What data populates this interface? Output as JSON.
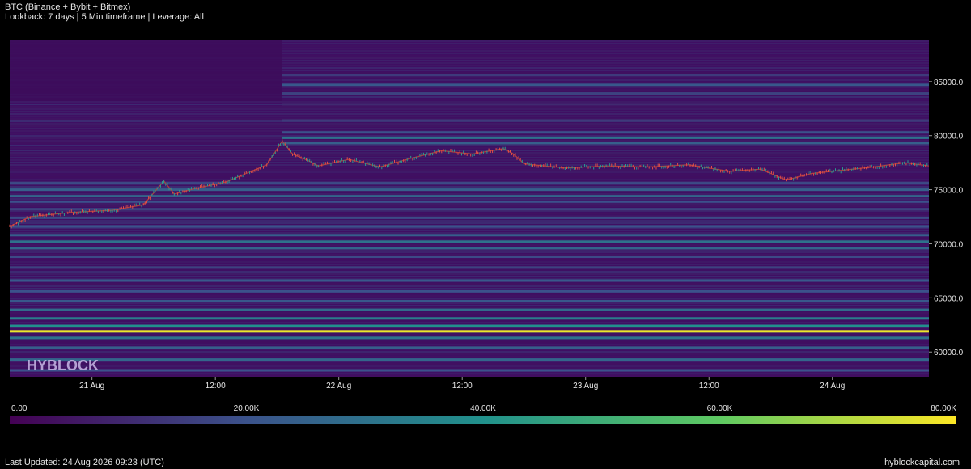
{
  "header": {
    "title": "BTC (Binance + Bybit + Bitmex)",
    "subtitle": "Lookback: 7 days | 5 Min timeframe | Leverage: All"
  },
  "watermark": "HYBLOCK",
  "footer": {
    "last_updated": "Last Updated: 24 Aug 2026 09:23 (UTC)",
    "site": "hyblockcapital.com"
  },
  "colors": {
    "background": "#000000",
    "heatmap_low": "#440154",
    "heatmap_mid1": "#3b528b",
    "heatmap_mid2": "#21918c",
    "heatmap_mid3": "#5ec962",
    "heatmap_high": "#fde725",
    "candle_up": "#26a69a",
    "candle_down": "#ef5350"
  },
  "chart_data": {
    "type": "heatmap",
    "description_of_overlay": "candlestick",
    "x_tick_labels": [
      "21 Aug",
      "12:00",
      "22 Aug",
      "12:00",
      "23 Aug",
      "12:00",
      "24 Aug"
    ],
    "x_range": [
      "2026-08-20T16:00",
      "2026-08-24T09:23"
    ],
    "x_ticks": [
      "2026-08-21T00:00",
      "2026-08-21T12:00",
      "2026-08-22T00:00",
      "2026-08-22T12:00",
      "2026-08-23T00:00",
      "2026-08-23T12:00",
      "2026-08-24T00:00"
    ],
    "y_tick_labels": [
      "85000.0",
      "80000.0",
      "75000.0",
      "70000.0",
      "65000.0",
      "60000.0"
    ],
    "y_ticks": [
      85000,
      80000,
      75000,
      70000,
      65000,
      60000
    ],
    "ylim": [
      57700,
      88800
    ],
    "colorbar": {
      "range": [
        0,
        80000
      ],
      "tick_labels": [
        "0.00",
        "20.00K",
        "40.00K",
        "60.00K",
        "80.00K"
      ],
      "tick_values": [
        0,
        20000,
        40000,
        60000,
        80000
      ]
    },
    "price_path": [
      [
        "2026-08-20T16:00",
        71600
      ],
      [
        "2026-08-20T18:00",
        72500
      ],
      [
        "2026-08-20T22:00",
        72900
      ],
      [
        "2026-08-21T02:00",
        73100
      ],
      [
        "2026-08-21T05:00",
        73600
      ],
      [
        "2026-08-21T07:00",
        75800
      ],
      [
        "2026-08-21T08:00",
        74600
      ],
      [
        "2026-08-21T10:00",
        75100
      ],
      [
        "2026-08-21T13:00",
        75700
      ],
      [
        "2026-08-21T15:00",
        76500
      ],
      [
        "2026-08-21T17:00",
        77300
      ],
      [
        "2026-08-21T18:30",
        79500
      ],
      [
        "2026-08-21T19:30",
        78300
      ],
      [
        "2026-08-21T21:00",
        77700
      ],
      [
        "2026-08-21T22:00",
        77200
      ],
      [
        "2026-08-22T01:00",
        77800
      ],
      [
        "2026-08-22T04:00",
        77100
      ],
      [
        "2026-08-22T07:00",
        77900
      ],
      [
        "2026-08-22T10:00",
        78600
      ],
      [
        "2026-08-22T13:00",
        78300
      ],
      [
        "2026-08-22T16:00",
        78800
      ],
      [
        "2026-08-22T17:00",
        78300
      ],
      [
        "2026-08-22T18:00",
        77400
      ],
      [
        "2026-08-22T22:00",
        77000
      ],
      [
        "2026-08-23T02:00",
        77200
      ],
      [
        "2026-08-23T06:00",
        77100
      ],
      [
        "2026-08-23T10:00",
        77300
      ],
      [
        "2026-08-23T14:00",
        76700
      ],
      [
        "2026-08-23T17:00",
        76900
      ],
      [
        "2026-08-23T19:30",
        75900
      ],
      [
        "2026-08-23T22:00",
        76500
      ],
      [
        "2026-08-24T01:00",
        76800
      ],
      [
        "2026-08-24T04:00",
        77100
      ],
      [
        "2026-08-24T07:00",
        77500
      ],
      [
        "2026-08-24T09:23",
        77200
      ]
    ],
    "liquidation_bands": [
      {
        "price": 87200,
        "value": 6000
      },
      {
        "price": 85600,
        "value": 14000
      },
      {
        "price": 84700,
        "value": 22000
      },
      {
        "price": 83900,
        "value": 16000
      },
      {
        "price": 82900,
        "value": 10000
      },
      {
        "price": 81400,
        "value": 14000
      },
      {
        "price": 80300,
        "value": 20000
      },
      {
        "price": 79800,
        "value": 30000
      },
      {
        "price": 79300,
        "value": 24000
      },
      {
        "price": 75600,
        "value": 18000
      },
      {
        "price": 75000,
        "value": 24000
      },
      {
        "price": 74400,
        "value": 26000
      },
      {
        "price": 73900,
        "value": 20000
      },
      {
        "price": 73200,
        "value": 16000
      },
      {
        "price": 72400,
        "value": 18000
      },
      {
        "price": 71600,
        "value": 20000
      },
      {
        "price": 70800,
        "value": 24000
      },
      {
        "price": 70200,
        "value": 30000
      },
      {
        "price": 69600,
        "value": 26000
      },
      {
        "price": 68800,
        "value": 18000
      },
      {
        "price": 67800,
        "value": 16000
      },
      {
        "price": 66600,
        "value": 22000
      },
      {
        "price": 65600,
        "value": 20000
      },
      {
        "price": 64700,
        "value": 22000
      },
      {
        "price": 63900,
        "value": 28000
      },
      {
        "price": 63100,
        "value": 34000
      },
      {
        "price": 62400,
        "value": 40000
      },
      {
        "price": 61900,
        "value": 78000
      },
      {
        "price": 61300,
        "value": 30000
      },
      {
        "price": 60400,
        "value": 24000
      },
      {
        "price": 59300,
        "value": 26000
      },
      {
        "price": 58300,
        "value": 20000
      }
    ]
  }
}
